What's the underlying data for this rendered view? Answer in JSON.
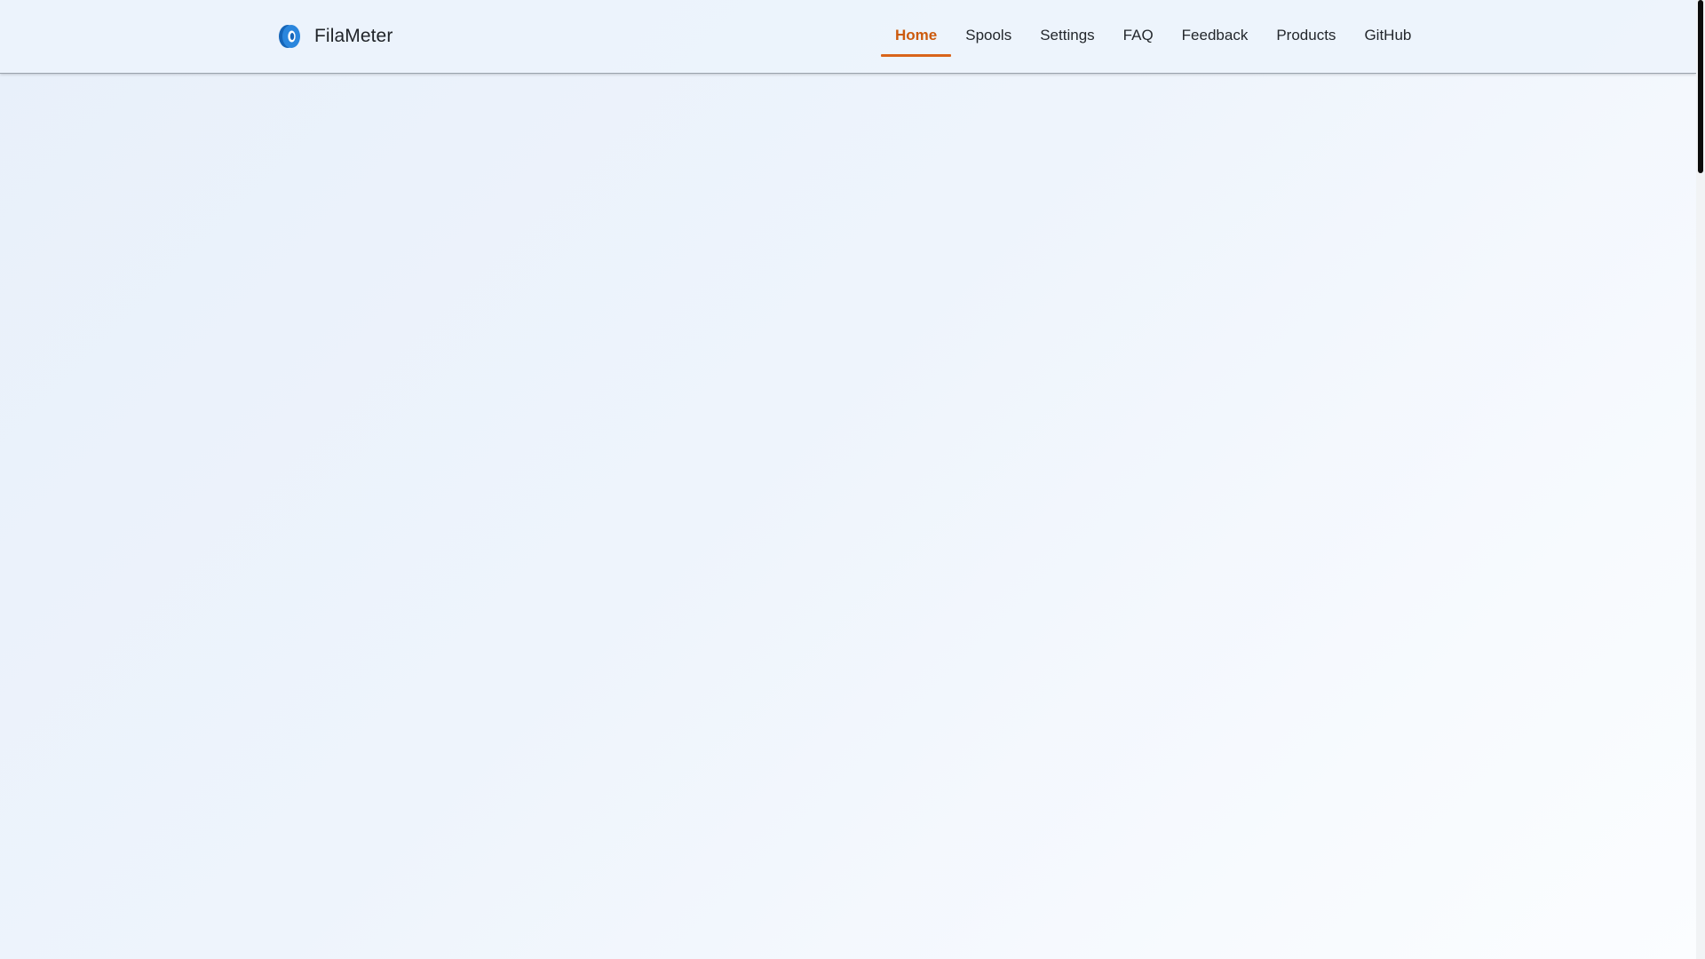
{
  "brand": {
    "name": "FilaMeter",
    "logo_icon": "filament-spool-icon",
    "logo_color": "#1a73c9"
  },
  "nav": {
    "items": [
      {
        "label": "Home",
        "active": true
      },
      {
        "label": "Spools",
        "active": false
      },
      {
        "label": "Settings",
        "active": false
      },
      {
        "label": "FAQ",
        "active": false
      },
      {
        "label": "Feedback",
        "active": false
      },
      {
        "label": "Products",
        "active": false
      },
      {
        "label": "GitHub",
        "active": false
      }
    ],
    "active_color": "#cc5a0c"
  },
  "page": {
    "background_start": "#e8f0fa",
    "background_end": "#fbfdff"
  }
}
